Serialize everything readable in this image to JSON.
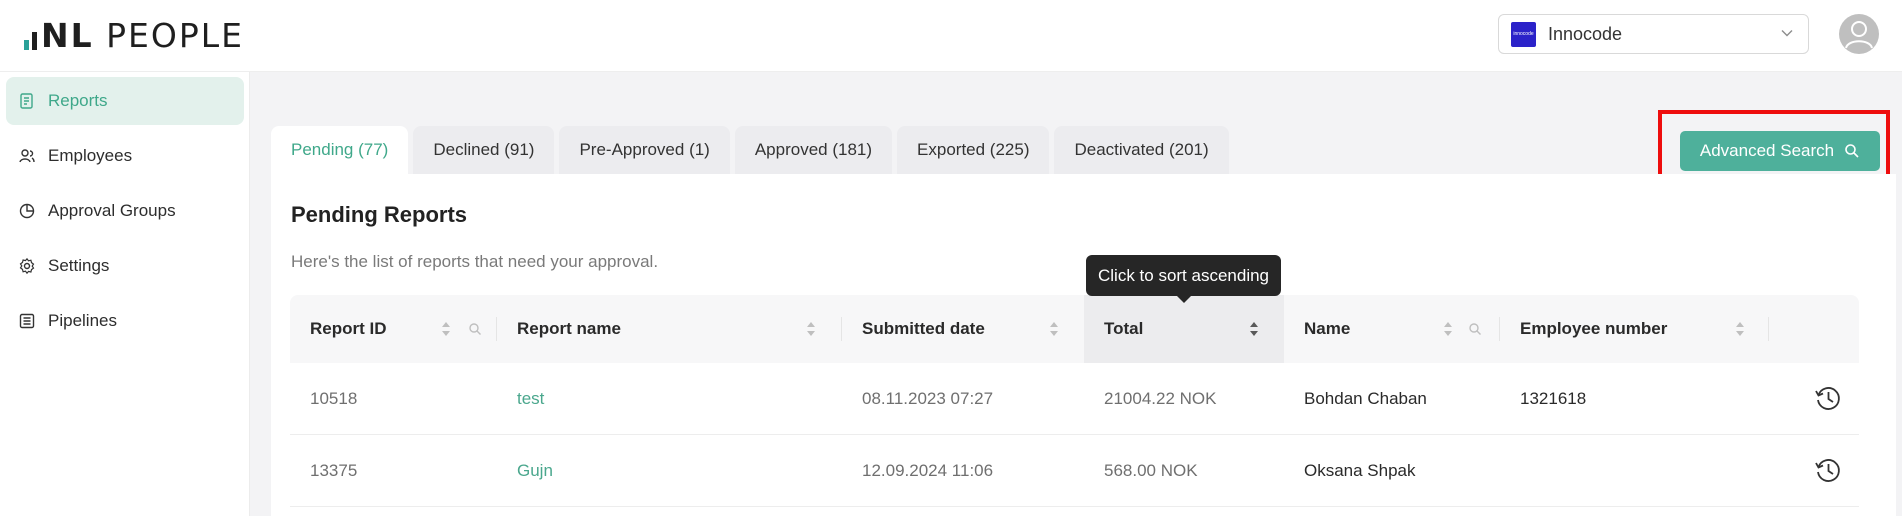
{
  "app": {
    "logo_text_bold": "NL",
    "logo_text": "PEOPLE"
  },
  "org_select": {
    "badge_text": "innocode",
    "value": "Innocode"
  },
  "sidebar": {
    "items": [
      {
        "label": "Reports",
        "icon": "reports-icon",
        "active": true
      },
      {
        "label": "Employees",
        "icon": "employees-icon",
        "active": false
      },
      {
        "label": "Approval Groups",
        "icon": "approval-groups-icon",
        "active": false
      },
      {
        "label": "Settings",
        "icon": "gear-icon",
        "active": false
      },
      {
        "label": "Pipelines",
        "icon": "pipelines-icon",
        "active": false
      }
    ]
  },
  "tabs": [
    {
      "label": "Pending (77)",
      "active": true
    },
    {
      "label": "Declined (91)",
      "active": false
    },
    {
      "label": "Pre-Approved (1)",
      "active": false
    },
    {
      "label": "Approved (181)",
      "active": false
    },
    {
      "label": "Exported (225)",
      "active": false
    },
    {
      "label": "Deactivated (201)",
      "active": false
    }
  ],
  "toolbar": {
    "advanced_search_label": "Advanced Search"
  },
  "panel": {
    "title": "Pending Reports",
    "subtitle": "Here's the list of reports that need your approval."
  },
  "tooltip": {
    "text": "Click to sort ascending"
  },
  "table": {
    "columns": [
      "Report ID",
      "Report name",
      "Submitted date",
      "Total",
      "Name",
      "Employee number"
    ],
    "rows": [
      {
        "report_id": "10518",
        "report_name": "test",
        "submitted": "08.11.2023 07:27",
        "total": "21004.22 NOK",
        "name": "Bohdan Chaban",
        "employee_number": "1321618"
      },
      {
        "report_id": "13375",
        "report_name": "Gujn",
        "submitted": "12.09.2024 11:06",
        "total": "568.00 NOK",
        "name": "Oksana Shpak",
        "employee_number": ""
      }
    ]
  },
  "colors": {
    "accent": "#4eb09b",
    "active_nav_bg": "#e3f1ec",
    "highlight": "#ee0d0d"
  }
}
